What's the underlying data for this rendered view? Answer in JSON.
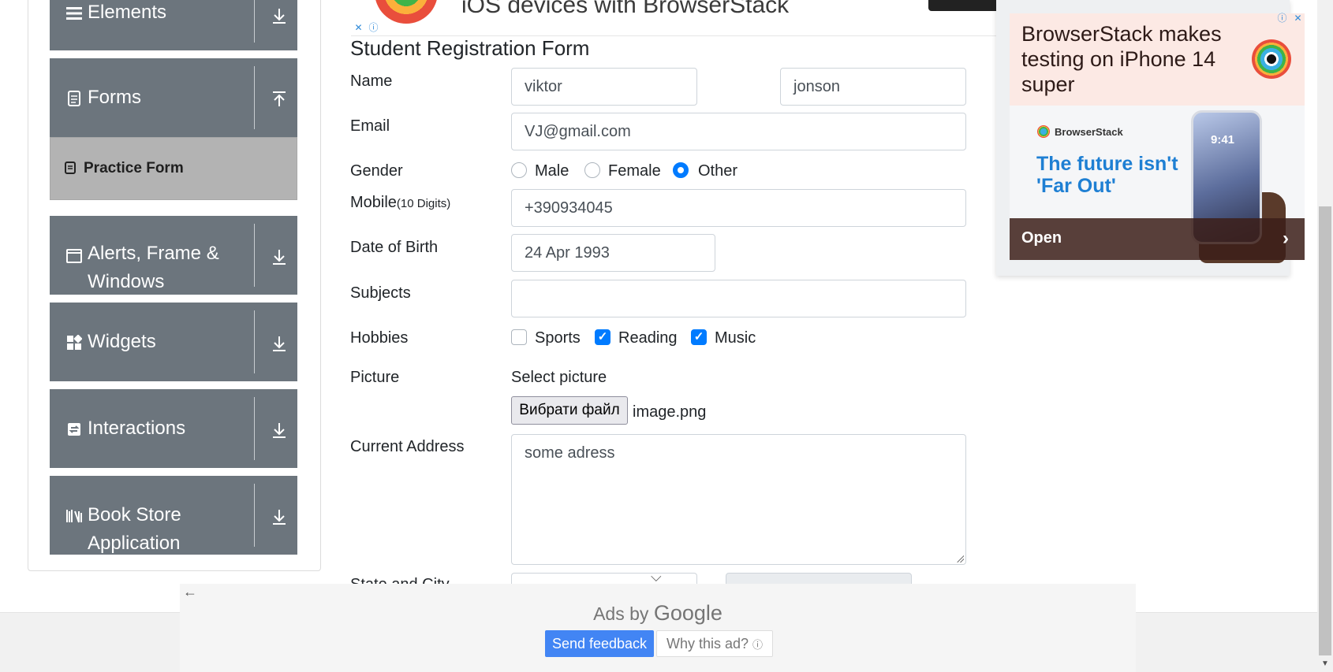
{
  "sidebar": {
    "groups": [
      {
        "label": "Elements",
        "icon": "list-icon",
        "toggle": "download-arrow-icon"
      },
      {
        "label": "Forms",
        "icon": "document-icon",
        "toggle": "upload-arrow-icon"
      },
      {
        "label": "Alerts, Frame & Windows",
        "icon": "window-icon",
        "toggle": "download-arrow-icon"
      },
      {
        "label": "Widgets",
        "icon": "widgets-icon",
        "toggle": "download-arrow-icon"
      },
      {
        "label": "Interactions",
        "icon": "interactions-icon",
        "toggle": "download-arrow-icon"
      },
      {
        "label": "Book Store Application",
        "icon": "books-icon",
        "toggle": "download-arrow-icon"
      }
    ],
    "active_item": "Practice Form"
  },
  "top_ad": {
    "text": "iOS devices with BrowserStack"
  },
  "form": {
    "title": "Student Registration Form",
    "name_label": "Name",
    "first_name": "viktor",
    "last_name": "jonson",
    "email_label": "Email",
    "email": "VJ@gmail.com",
    "gender_label": "Gender",
    "gender_options": [
      "Male",
      "Female",
      "Other"
    ],
    "gender_selected": "Other",
    "mobile_label": "Mobile",
    "mobile_hint": "(10 Digits)",
    "mobile": "+390934045",
    "dob_label": "Date of Birth",
    "dob": "24 Apr 1993",
    "subjects_label": "Subjects",
    "subjects": "",
    "hobbies_label": "Hobbies",
    "hobbies": [
      {
        "label": "Sports",
        "checked": false
      },
      {
        "label": "Reading",
        "checked": true
      },
      {
        "label": "Music",
        "checked": true
      }
    ],
    "picture_label": "Picture",
    "select_picture": "Select picture",
    "file_button": "Вибрати файл",
    "file_name": "image.png",
    "address_label": "Current Address",
    "address": "some adress",
    "state_city_label": "State and City"
  },
  "right_ad": {
    "headline": "BrowserStack makes testing on iPhone 14 super",
    "brand": "BrowserStack",
    "tagline": "The future isn't 'Far Out'",
    "phone_time": "9:41",
    "cta": "Open"
  },
  "google_ad": {
    "ads_by": "Ads by",
    "google": "Google",
    "feedback": "Send feedback",
    "why": "Why this ad?"
  },
  "colors": {
    "sidebar_group": "#6c757d",
    "active_item": "#b3b3b3",
    "accent": "#007bff",
    "feedback_btn": "#4285f4"
  }
}
